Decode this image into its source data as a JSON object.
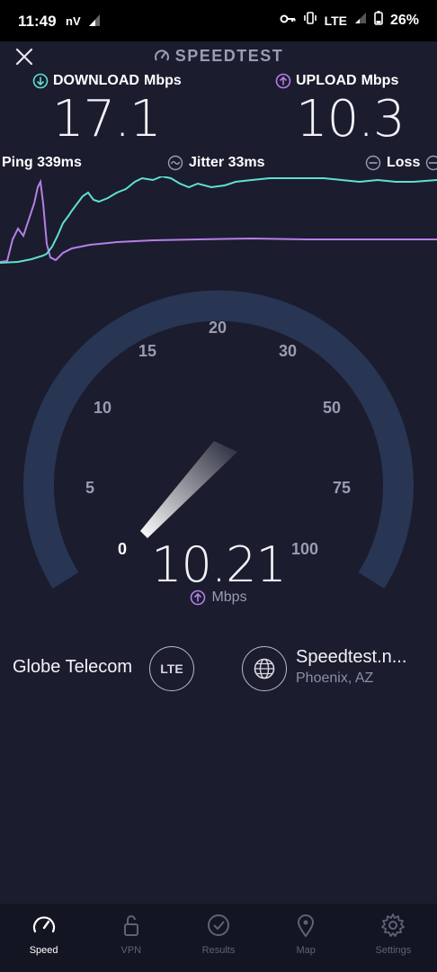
{
  "status_bar": {
    "time": "11:49",
    "carrier": "nV",
    "network": "LTE",
    "battery": "26%"
  },
  "header": {
    "title": "SPEEDTEST"
  },
  "download": {
    "label": "DOWNLOAD",
    "unit": "Mbps",
    "value": "17.1",
    "color": "#5fe0d0"
  },
  "upload": {
    "label": "UPLOAD",
    "unit": "Mbps",
    "value": "10.3",
    "color": "#b57fe6"
  },
  "stats": {
    "ping": "Ping 339ms",
    "jitter": "Jitter 33ms",
    "loss": "Loss"
  },
  "gauge": {
    "ticks": [
      "0",
      "5",
      "10",
      "15",
      "20",
      "30",
      "50",
      "75",
      "100"
    ],
    "value": "10.21",
    "unit": "Mbps"
  },
  "provider": {
    "name": "Globe Telecom",
    "badge": "LTE"
  },
  "server": {
    "name": "Speedtest.n...",
    "location": "Phoenix, AZ"
  },
  "nav": [
    {
      "label": "Speed",
      "icon": "speedometer-icon",
      "active": true
    },
    {
      "label": "VPN",
      "icon": "lock-icon",
      "active": false
    },
    {
      "label": "Results",
      "icon": "check-circle-icon",
      "active": false
    },
    {
      "label": "Map",
      "icon": "map-pin-icon",
      "active": false
    },
    {
      "label": "Settings",
      "icon": "gear-icon",
      "active": false
    }
  ]
}
